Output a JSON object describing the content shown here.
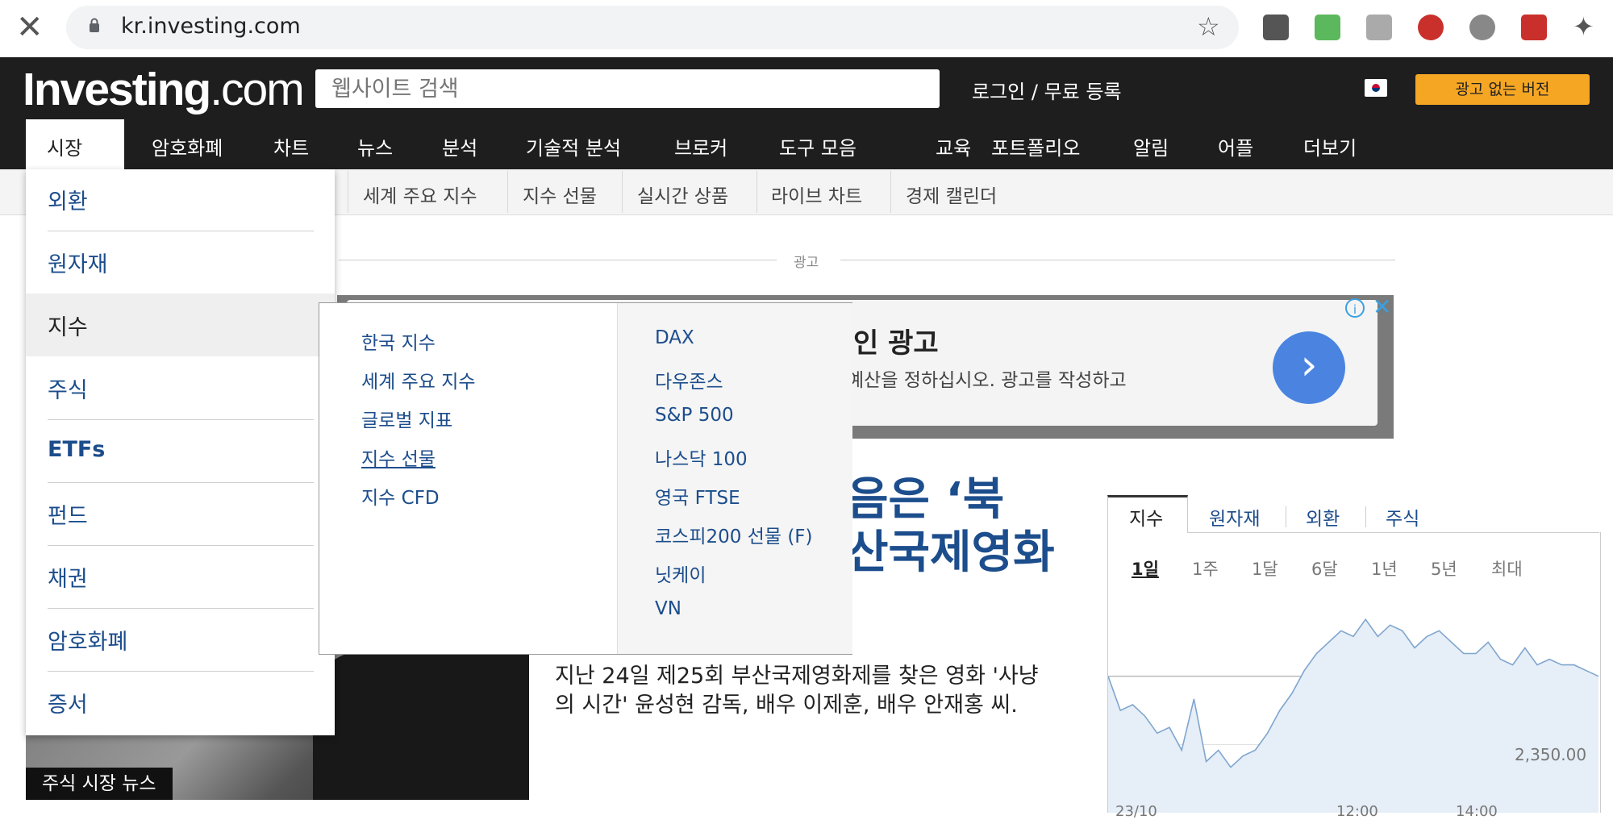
{
  "browser": {
    "url": "kr.investing.com"
  },
  "site": {
    "logo_main": "Investing",
    "logo_dot": ".com",
    "search_placeholder": "웹사이트 검색",
    "login": "로그인 / 무료 등록",
    "noads": "광고 없는 버전"
  },
  "nav": [
    "시장",
    "암호화폐",
    "차트",
    "뉴스",
    "분석",
    "기술적 분석",
    "브로커",
    "도구 모음",
    "교육",
    "포트폴리오",
    "알림",
    "어플",
    "더보기"
  ],
  "subnav": [
    "세계 주요 지수",
    "지수 선물",
    "실시간 상품",
    "라이브 차트",
    "경제 캘린더"
  ],
  "ad": {
    "label": "광고",
    "title": "인 광고",
    "body1": "예산을 정하십시오. 광고를 작성하고",
    "body2": "."
  },
  "article": {
    "headline1": "음은 ‘북",
    "headline2": "산국제영화",
    "photo_label": "주식 시장 뉴스",
    "excerpt1": "지난 24일 제25회 부산국제영화제를 찾은 영화 '사냥",
    "excerpt2": "의 시간' 윤성현 감독, 배우 이제훈, 배우 안재홍 씨."
  },
  "market_widget": {
    "tabs": [
      "지수",
      "원자재",
      "외환",
      "주식"
    ],
    "ranges": [
      "1일",
      "1주",
      "1달",
      "6달",
      "1년",
      "5년",
      "최대"
    ]
  },
  "chart_data": {
    "type": "line",
    "y_tick_labels": [
      "2,350.00"
    ],
    "x_tick_labels": [
      "23/10",
      "12:00",
      "14:00"
    ],
    "series_values": [
      2362,
      2356,
      2357,
      2355,
      2352,
      2353,
      2349,
      2358,
      2347,
      2349,
      2346,
      2348,
      2349,
      2352,
      2356,
      2359,
      2363,
      2366,
      2368,
      2370,
      2369,
      2372,
      2369,
      2371,
      2370,
      2367,
      2369,
      2370,
      2368,
      2366,
      2366,
      2368,
      2365,
      2364,
      2367,
      2364,
      2365,
      2364,
      2364,
      2363,
      2362
    ],
    "reference_value": 2362,
    "color": "#7fa6cf",
    "fill": "#e6eef7"
  },
  "menu": {
    "left": [
      "외환",
      "원자재",
      "지수",
      "주식",
      "ETFs",
      "펀드",
      "채권",
      "암호화폐",
      "증서"
    ],
    "col1": [
      "한국 지수",
      "세계 주요 지수",
      "글로벌 지표",
      "지수 선물",
      "지수 CFD"
    ],
    "col2": [
      "DAX",
      "다우존스",
      "S&P 500",
      "나스닥 100",
      "영국 FTSE",
      "코스피200 선물 (F)",
      "닛케이",
      "VN"
    ]
  }
}
